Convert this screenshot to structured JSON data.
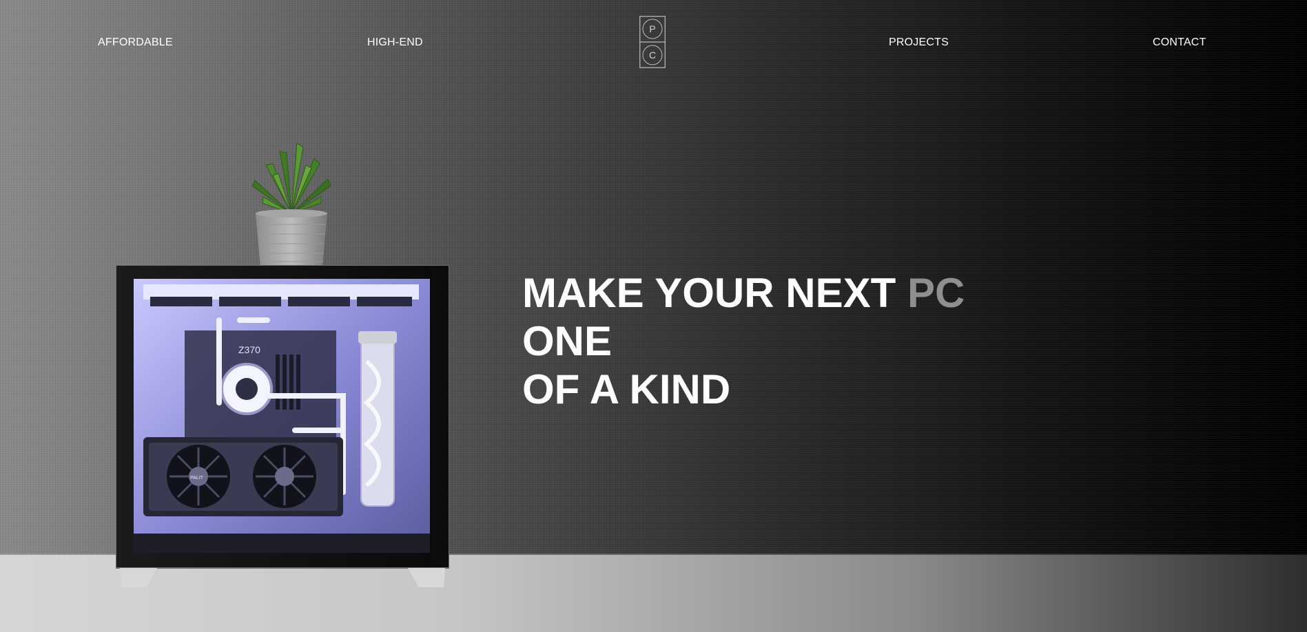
{
  "nav": {
    "left": [
      {
        "label": "AFFORDABLE"
      },
      {
        "label": "HIGH-END"
      }
    ],
    "right": [
      {
        "label": "PROJECTS"
      },
      {
        "label": "CONTACT"
      }
    ],
    "logo": {
      "top_letter": "P",
      "bottom_letter": "C"
    }
  },
  "hero": {
    "headline_part1": "MAKE YOUR NEXT ",
    "headline_accent": "PC",
    "headline_part2": " ONE",
    "headline_line2": "OF A KIND",
    "gpu_brand": "PALIT",
    "motherboard_label": "Z370"
  },
  "colors": {
    "headline": "#ffffff",
    "accent": "#8f8f8f",
    "nav_text": "#ffffff",
    "background_dark": "#000000",
    "case_glow": "#b9b9ff"
  },
  "icons": [
    "pc-logo-icon"
  ]
}
